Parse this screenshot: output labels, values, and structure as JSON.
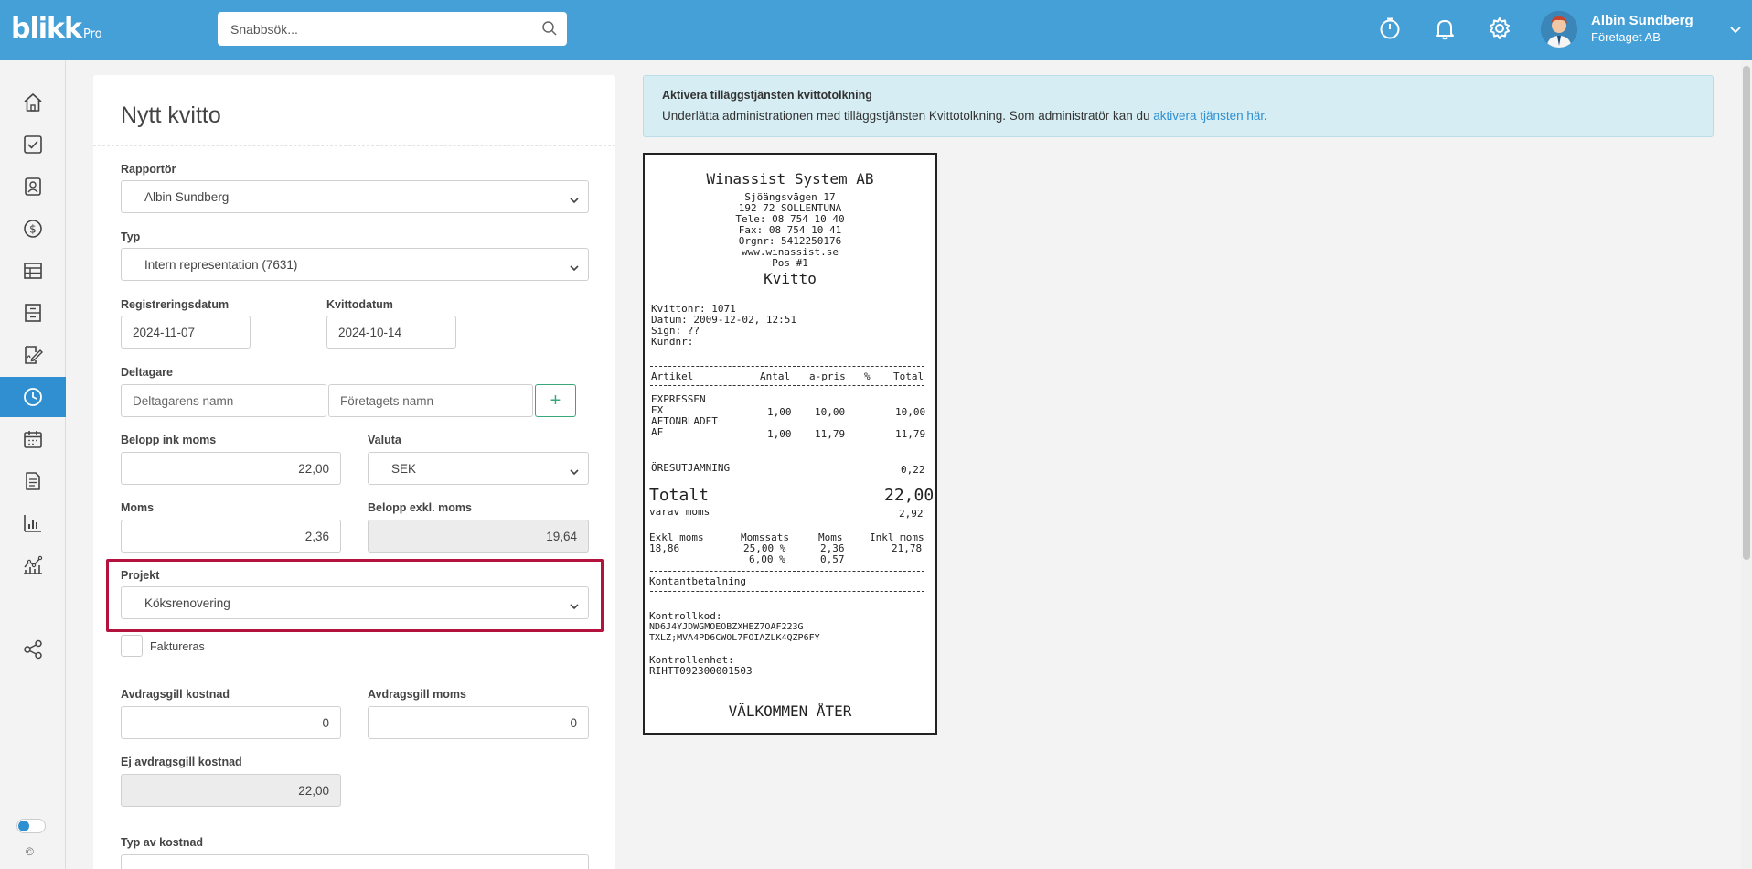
{
  "header": {
    "logo": "blikk",
    "logo_suffix": "Pro",
    "search_placeholder": "Snabbsök...",
    "user_name": "Albin Sundberg",
    "user_company": "Företaget AB",
    "icons": [
      "stopwatch-icon",
      "bell-icon",
      "gear-icon"
    ]
  },
  "sidebar": {
    "items": [
      "home-icon",
      "tasks-icon",
      "contacts-icon",
      "money-icon",
      "table-icon",
      "archive-icon",
      "signature-icon",
      "clock-icon",
      "calendar-icon",
      "document-icon",
      "bar-chart-icon",
      "line-chart-icon",
      "share-icon"
    ],
    "active": "clock-icon",
    "copyright": "©"
  },
  "form": {
    "title": "Nytt kvitto",
    "reporter_label": "Rapportör",
    "reporter_value": "Albin Sundberg",
    "type_label": "Typ",
    "type_value": "Intern representation (7631)",
    "reg_date_label": "Registreringsdatum",
    "reg_date_value": "2024-11-07",
    "receipt_date_label": "Kvittodatum",
    "receipt_date_value": "2024-10-14",
    "participants_label": "Deltagare",
    "participant_name_placeholder": "Deltagarens namn",
    "company_name_placeholder": "Företagets namn",
    "add_symbol": "+",
    "amount_incl_label": "Belopp ink moms",
    "amount_incl_value": "22,00",
    "currency_label": "Valuta",
    "currency_value": "SEK",
    "vat_label": "Moms",
    "vat_value": "2,36",
    "amount_excl_label": "Belopp exkl. moms",
    "amount_excl_value": "19,64",
    "project_label": "Projekt",
    "project_value": "Köksrenovering",
    "invoiced_label": "Faktureras",
    "deductible_cost_label": "Avdragsgill kostnad",
    "deductible_cost_value": "0",
    "deductible_vat_label": "Avdragsgill moms",
    "deductible_vat_value": "0",
    "non_deductible_label": "Ej avdragsgill kostnad",
    "non_deductible_value": "22,00",
    "cost_type_label": "Typ av kostnad"
  },
  "banner": {
    "title": "Aktivera tilläggstjänsten kvittotolkning",
    "text": "Underlätta administrationen med tilläggstjänsten Kvittotolkning. Som administratör kan du ",
    "link": "aktivera tjänsten här",
    "suffix": "."
  },
  "receipt": {
    "company": "Winassist System AB",
    "address1": "Sjöängsvägen 17",
    "address2": "192 72 SOLLENTUNA",
    "phone": "Tele: 08 754 10 40",
    "fax": "Fax: 08 754 10 41",
    "orgnr": "Orgnr: 5412250176",
    "web": "www.winassist.se",
    "pos": "Pos #1",
    "heading": "Kvitto",
    "receipt_no": "Kvittonr: 1071",
    "date": "Datum: 2009-12-02, 12:51",
    "sign": "Sign: ??",
    "customer": "Kundnr:",
    "col_article": "Artikel",
    "col_qty": "Antal",
    "col_price": "a-pris",
    "col_pct": "%",
    "col_total": "Total",
    "item1_name": "EXPRESSEN",
    "item1_code": "EX",
    "item1_qty": "1,00",
    "item1_price": "10,00",
    "item1_total": "10,00",
    "item2_name": "AFTONBLADET",
    "item2_code": "AF",
    "item2_qty": "1,00",
    "item2_price": "11,79",
    "item2_total": "11,79",
    "rounding_label": "ÖRESUTJAMNING",
    "rounding_value": "0,22",
    "total_label": "Totalt",
    "total_value": "22,00",
    "vat_label": "varav moms",
    "vat_value": "2,92",
    "excl_label": "Exkl moms",
    "excl_value": "18,86",
    "rate_label": "Momssats",
    "rate1": "25,00 %",
    "rate2": "6,00 %",
    "moms_label": "Moms",
    "moms1": "2,36",
    "moms2": "0,57",
    "incl_label": "Inkl moms",
    "incl_value": "21,78",
    "payment": "Kontantbetalning",
    "control_code_label": "Kontrollkod:",
    "control_code_1": "ND6J4YJDWGMOEOBZXHEZ7OAF223G",
    "control_code_2": "TXLZ;MVA4PD6CWOL7FOIAZLK4QZP6FY",
    "control_unit_label": "Kontrollenhet:",
    "control_unit_value": "RIHTT092300001503",
    "farewell": "VÄLKOMMEN ÅTER"
  }
}
